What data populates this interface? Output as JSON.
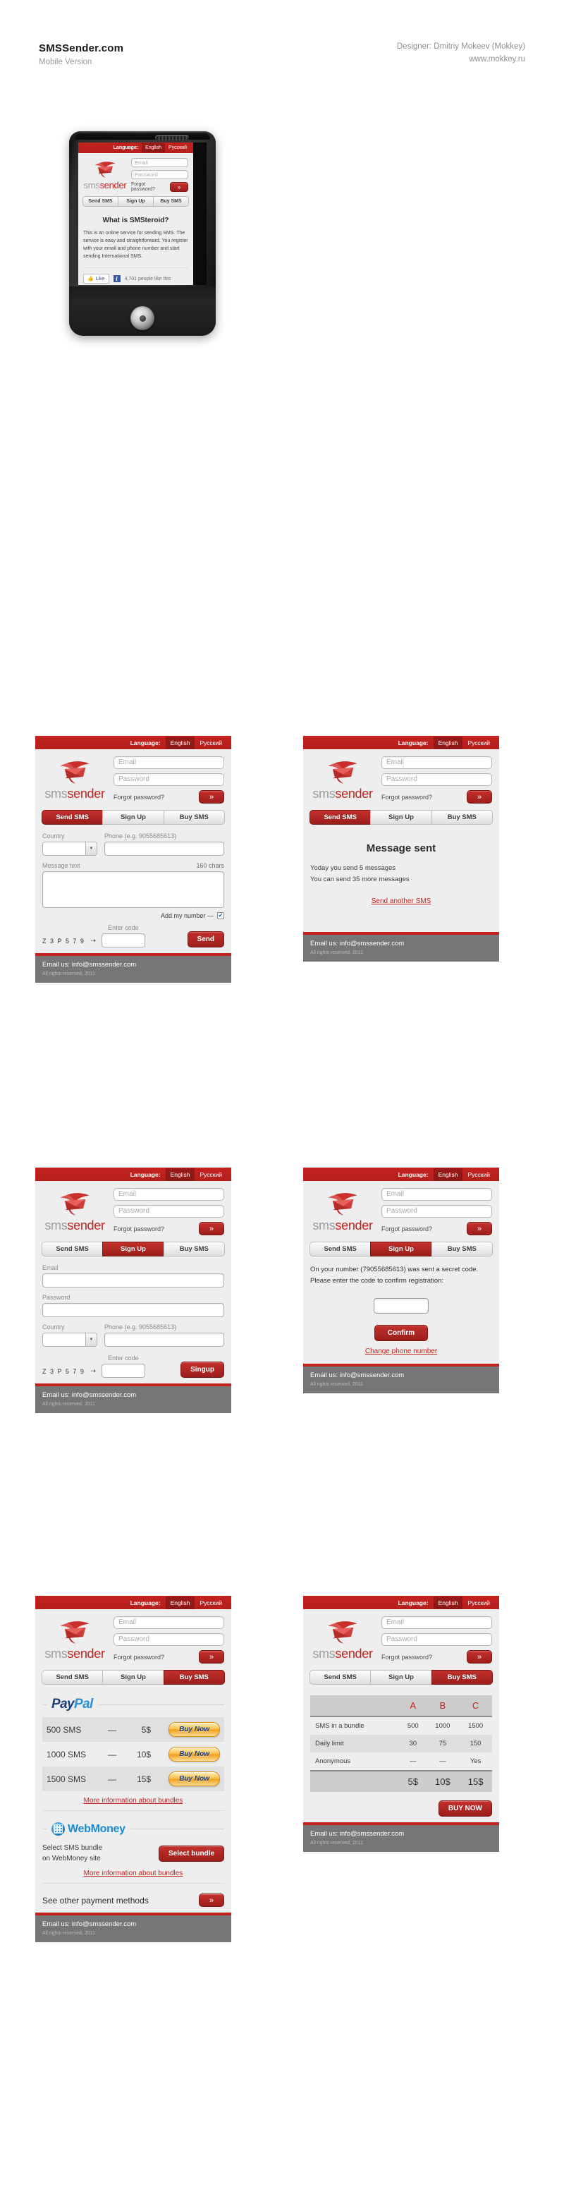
{
  "header": {
    "title": "SMSSender.com",
    "subtitle": "Mobile Version",
    "designer": "Designer: Dmitriy Mokeev (Mokkey)",
    "url": "www.mokkey.ru"
  },
  "brand": {
    "logo_text_gray": "sms",
    "logo_text_red": "sender",
    "accent": "#c4221f",
    "footer_bg": "#767676"
  },
  "lang": {
    "label": "Language:",
    "options": [
      "English",
      "Русский"
    ],
    "selected": "English"
  },
  "login": {
    "email_placeholder": "Email",
    "password_placeholder": "Password",
    "forgot": "Forgot password?",
    "go_icon": "»"
  },
  "tabs": [
    "Send SMS",
    "Sign Up",
    "Buy SMS"
  ],
  "footer": {
    "email": "Email us: info@smssender.com",
    "copyright": "All rights reserved, 2011"
  },
  "phone_screen": {
    "heading": "What is SMSteroid?",
    "body": "This is an online service for sending SMS. The service is easy and straightforward. You register with your email and phone number and start sending International SMS.",
    "fb_like": "Like",
    "fb_count": "4,701 people like this",
    "nav": {
      "home": "home-icon",
      "menu": "menu",
      "back": "back-icon",
      "search": "search-icon"
    }
  },
  "send_sms": {
    "active_tab": "Send SMS",
    "country_label": "Country",
    "country_value": "",
    "phone_label": "Phone (e.g. 9055685613)",
    "phone_value": "",
    "message_label": "Message text",
    "chars": "160 chars",
    "message_value": "",
    "add_my_number": "Add my number —",
    "add_my_number_checked": true,
    "enter_code_label": "Enter code",
    "captcha": "Z 3 P 5 7 9",
    "captcha_arrow": "⇢",
    "code_value": "",
    "submit": "Send"
  },
  "message_sent": {
    "active_tab": "Send SMS",
    "title": "Message sent",
    "line1": "Yoday you send 5 messages",
    "line2": "You can send 35 more messages",
    "link": "Send another SMS"
  },
  "sign_up": {
    "active_tab": "Sign Up",
    "email_label": "Email",
    "email_value": "",
    "password_label": "Password",
    "password_value": "",
    "country_label": "Country",
    "phone_label": "Phone (e.g. 9055685613)",
    "enter_code_label": "Enter code",
    "captcha": "Z 3 P 5 7 9",
    "captcha_arrow": "⇢",
    "code_value": "",
    "submit": "Singup"
  },
  "confirm": {
    "active_tab": "Sign Up",
    "text_line1": "On your number (79055685613) was sent a secret code.",
    "text_line2": "Please enter the code to confirm registration:",
    "code_value": "",
    "submit": "Confirm",
    "link": "Change phone number"
  },
  "buy_sms": {
    "active_tab": "Buy SMS",
    "paypal": {
      "part1": "Pay",
      "part2": "Pal"
    },
    "bundles": [
      {
        "name": "500 SMS",
        "dash": "—",
        "price": "5$",
        "button": "Buy Now"
      },
      {
        "name": "1000 SMS",
        "dash": "—",
        "price": "10$",
        "button": "Buy Now"
      },
      {
        "name": "1500 SMS",
        "dash": "—",
        "price": "15$",
        "button": "Buy Now"
      }
    ],
    "more_info": "More information about bundles",
    "webmoney": {
      "name": "WebMoney",
      "desc_line1": "Select SMS bundle",
      "desc_line2": "on WebMoney site",
      "button": "Select bundle"
    },
    "more_info_2": "More information about bundles",
    "see_other": "See other payment methods",
    "see_other_icon": "»"
  },
  "compare": {
    "active_tab": "Buy SMS",
    "columns": [
      "",
      "A",
      "B",
      "C"
    ],
    "rows": [
      {
        "label": "SMS in a bundle",
        "values": [
          "500",
          "1000",
          "1500"
        ],
        "shaded": false
      },
      {
        "label": "Daily limit",
        "values": [
          "30",
          "75",
          "150"
        ],
        "shaded": true
      },
      {
        "label": "Anonymous",
        "values": [
          "—",
          "—",
          "Yes"
        ],
        "shaded": false
      }
    ],
    "prices": [
      "5$",
      "10$",
      "15$"
    ],
    "buy_button": "BUY NOW"
  }
}
